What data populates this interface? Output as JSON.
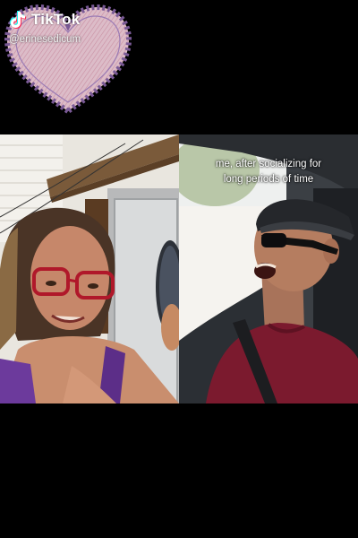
{
  "watermark": {
    "brand": "TikTok",
    "handle": "@erinesedicum",
    "logo_icon": "tiktok-note-icon",
    "sticker_icon": "heart-sticker-icon"
  },
  "right_video": {
    "caption_line1": "me, after socializing for",
    "caption_line2": "long periods of time"
  },
  "colors": {
    "background": "#000000",
    "heart_fill": "#d7b4c4",
    "heart_border": "#6a4e8a",
    "shirt": "#7b1a2e",
    "top_purple": "#6c3a9c"
  }
}
